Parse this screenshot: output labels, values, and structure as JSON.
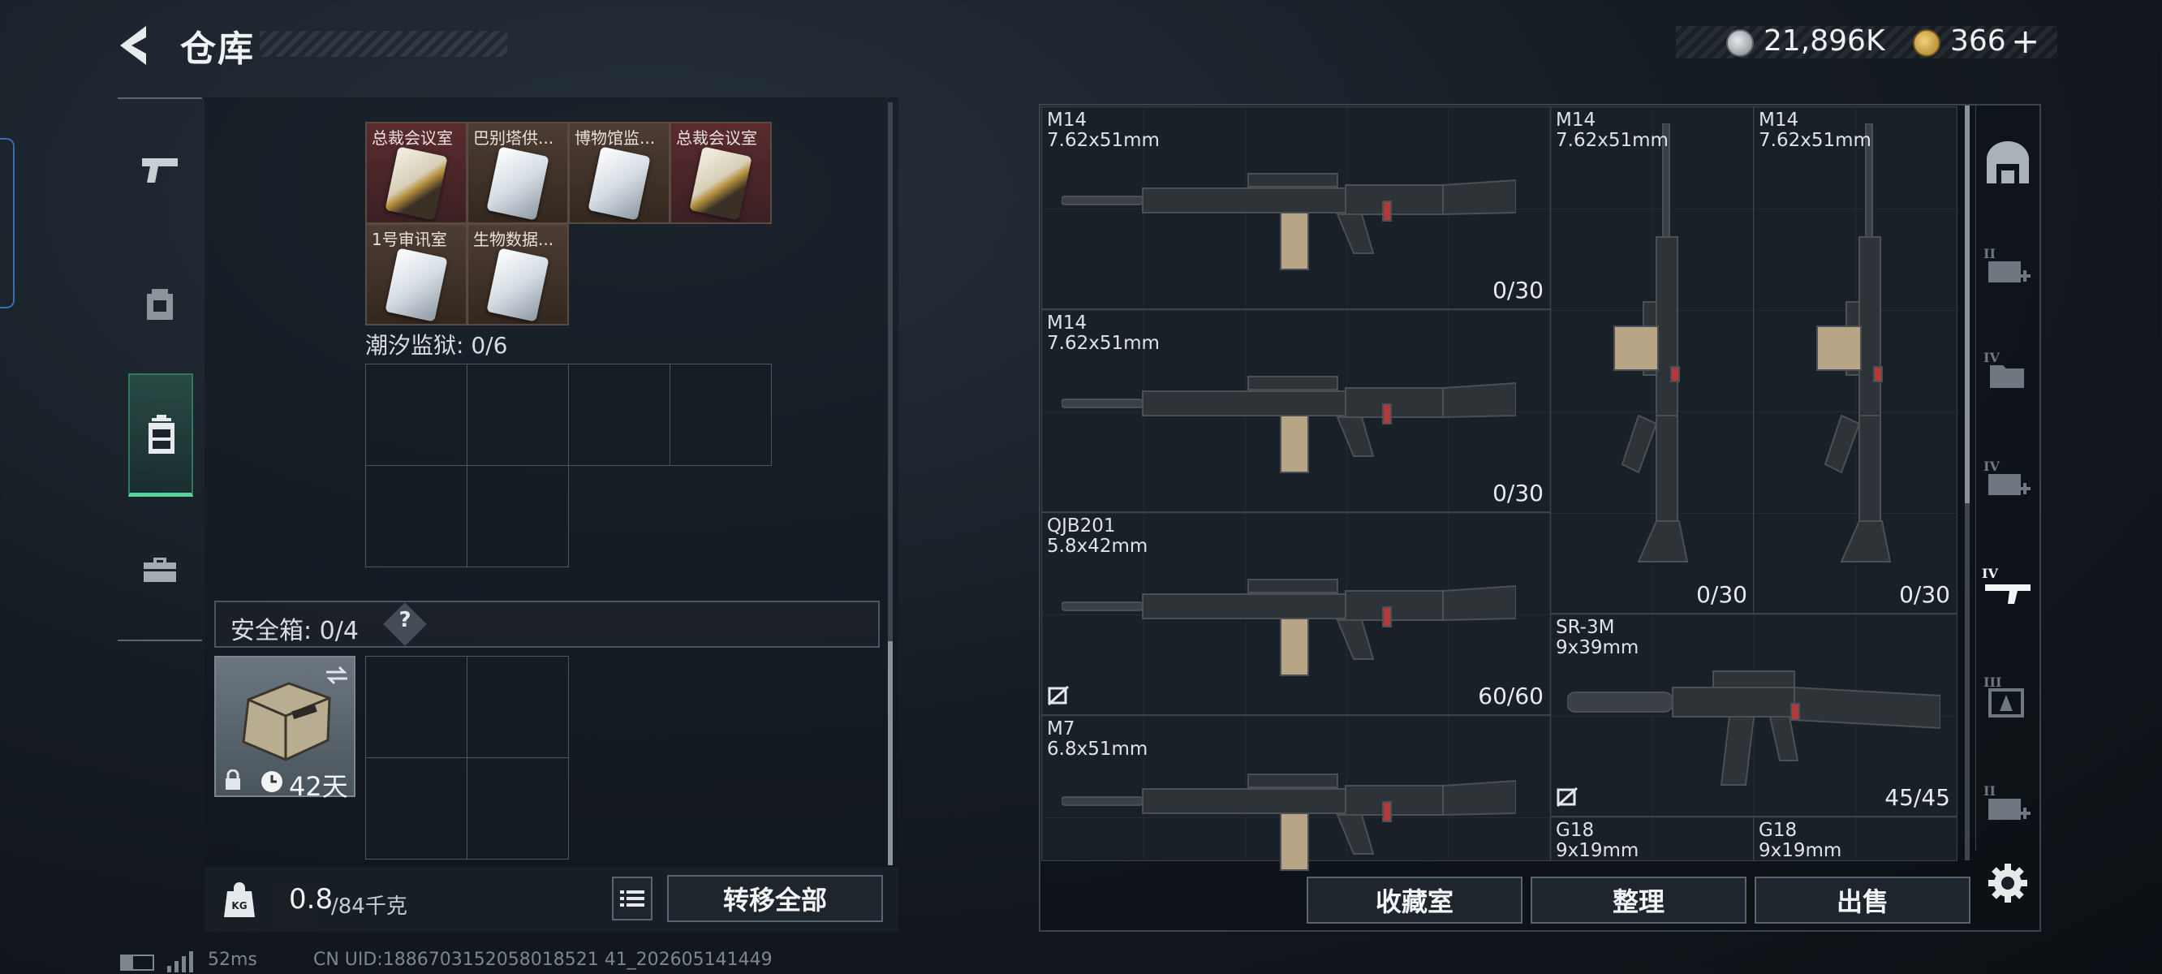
{
  "header": {
    "title": "仓库",
    "silver_amount": "21,896K",
    "gold_amount": "366",
    "gold_plus": "+"
  },
  "left_nav": {
    "items": [
      {
        "name": "weapons",
        "icon": "pistol-icon",
        "active": false
      },
      {
        "name": "equipment",
        "icon": "backpack-icon",
        "active": false
      },
      {
        "name": "bag",
        "icon": "bag-icon",
        "active": true
      },
      {
        "name": "case",
        "icon": "briefcase-icon",
        "active": false
      }
    ]
  },
  "storage": {
    "cards_row1": [
      {
        "label": "总裁会议室",
        "style": "red",
        "card": "gold"
      },
      {
        "label": "巴别塔供...",
        "style": "brown",
        "card": "white"
      },
      {
        "label": "博物馆监...",
        "style": "brown",
        "card": "white"
      },
      {
        "label": "总裁会议室",
        "style": "red",
        "card": "gold"
      }
    ],
    "cards_row2": [
      {
        "label": "1号审讯室",
        "style": "brown",
        "card": "white"
      },
      {
        "label": "生物数据...",
        "style": "brown",
        "card": "white"
      }
    ],
    "tidal_prison_label": "潮汐监狱: 0/6",
    "safe_box_label": "安全箱: 0/4",
    "help_label": "?",
    "safe_item_days": "42天"
  },
  "bottom": {
    "weight_value": "0.8",
    "weight_max": "/84千克",
    "transfer_all": "转移全部"
  },
  "weapons": [
    {
      "name": "M14",
      "caliber": "7.62x51mm",
      "ammo": "0/30"
    },
    {
      "name": "M14",
      "caliber": "7.62x51mm",
      "ammo": "0/30"
    },
    {
      "name": "QJB201",
      "caliber": "5.8x42mm",
      "ammo": "60/60"
    },
    {
      "name": "M7",
      "caliber": "6.8x51mm",
      "ammo": ""
    },
    {
      "name": "M14",
      "caliber": "7.62x51mm",
      "ammo": "0/30"
    },
    {
      "name": "M14",
      "caliber": "7.62x51mm",
      "ammo": "0/30"
    },
    {
      "name": "SR-3M",
      "caliber": "9x39mm",
      "ammo": "45/45"
    },
    {
      "name": "G18",
      "caliber": "9x19mm",
      "ammo": ""
    },
    {
      "name": "G18",
      "caliber": "9x19mm",
      "ammo": ""
    }
  ],
  "actions": {
    "collection": "收藏室",
    "organize": "整理",
    "sell": "出售"
  },
  "status": {
    "ping": "52ms",
    "uid": "CN UID:1886703152058018521 41_202605141449"
  }
}
